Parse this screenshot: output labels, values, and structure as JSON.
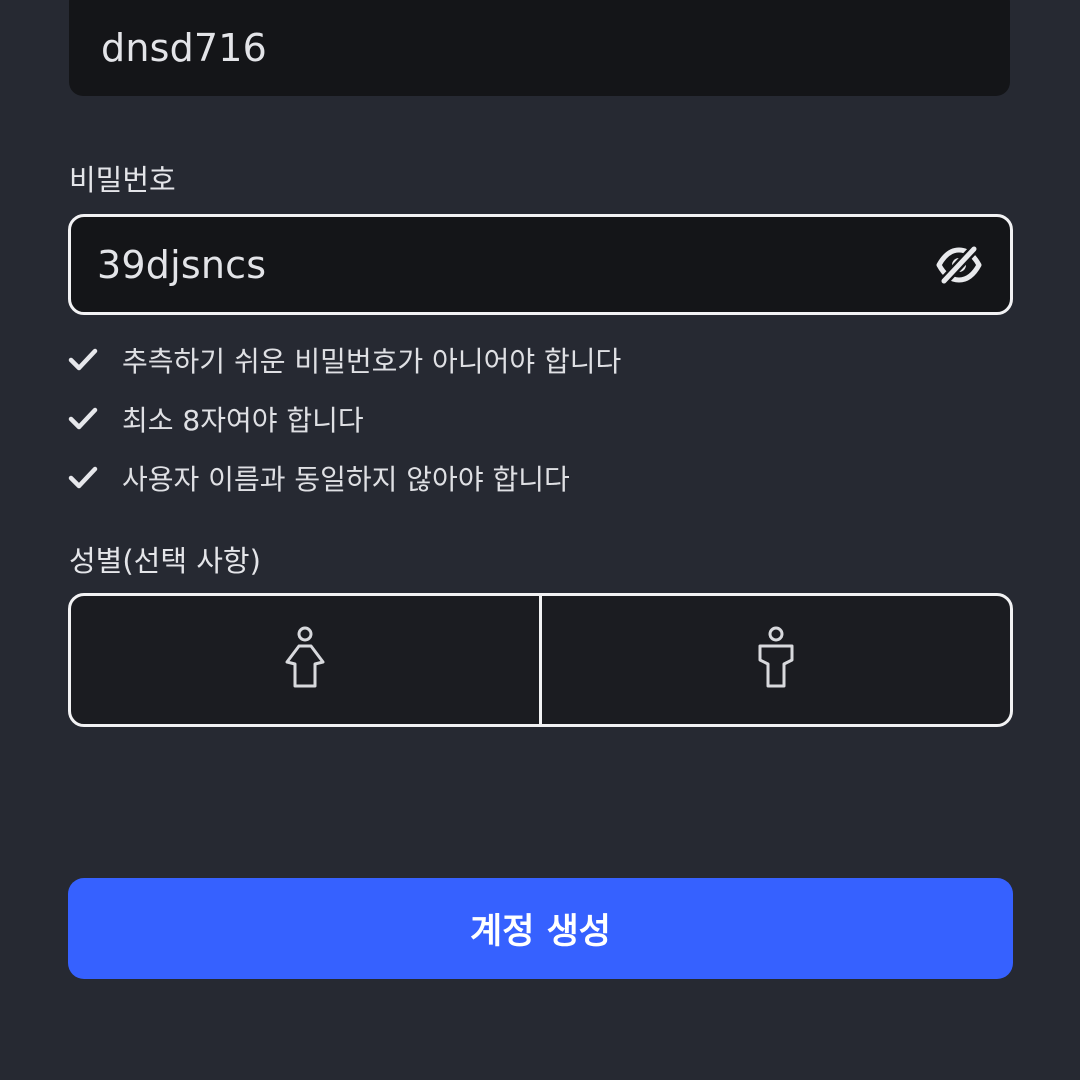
{
  "username": {
    "value": "dnsd716"
  },
  "password": {
    "label": "비밀번호",
    "value": "39djsncs",
    "toggle_icon": "eye-off-icon"
  },
  "rules": [
    {
      "text": "추측하기 쉬운 비밀번호가 아니어야 합니다",
      "icon": "check-icon",
      "passed": true
    },
    {
      "text": "최소 8자여야 합니다",
      "icon": "check-icon",
      "passed": true
    },
    {
      "text": "사용자 이름과 동일하지 않아야 합니다",
      "icon": "check-icon",
      "passed": true
    }
  ],
  "gender": {
    "label": "성별(선택 사항)",
    "options": [
      {
        "icon": "female-icon"
      },
      {
        "icon": "male-icon"
      }
    ]
  },
  "submit": {
    "label": "계정 생성"
  },
  "colors": {
    "background": "#262932",
    "field": "#141518",
    "accent": "#3661ff",
    "border": "#f2f2f4"
  }
}
